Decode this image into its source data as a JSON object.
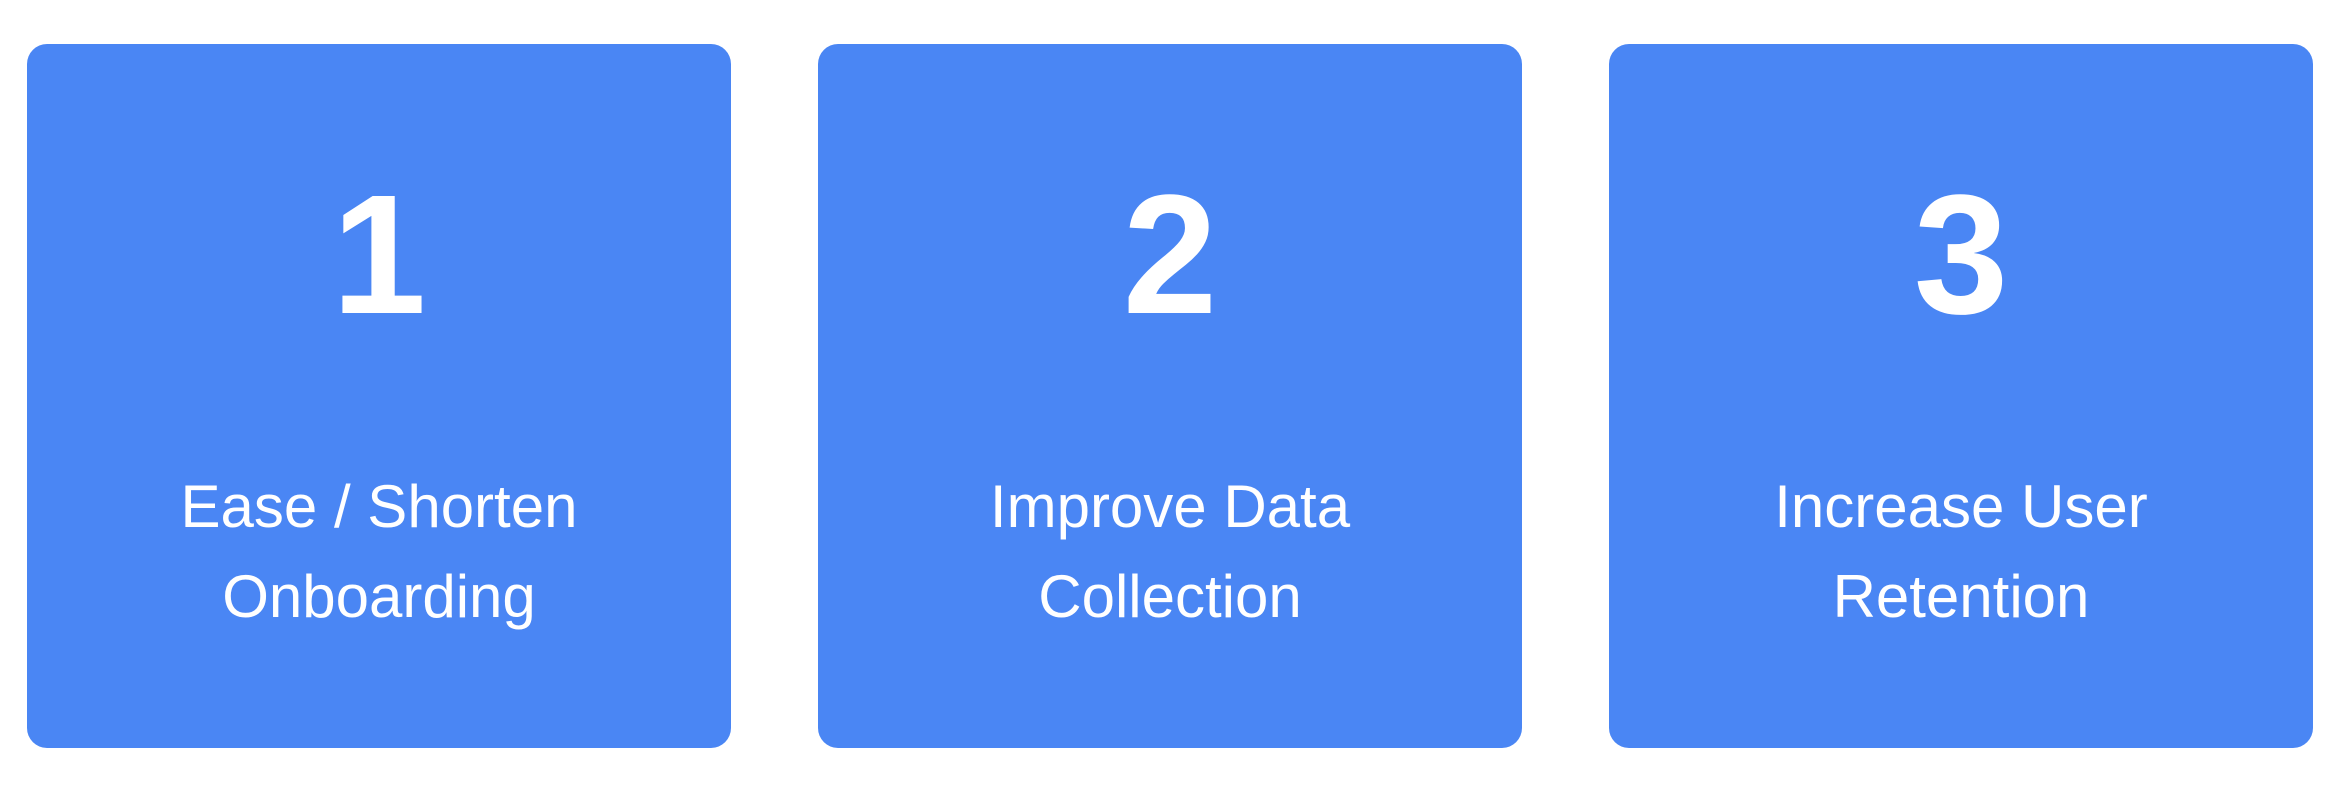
{
  "colors": {
    "card_background": "#4a86f4",
    "card_text": "#ffffff",
    "page_background": "#ffffff"
  },
  "cards": [
    {
      "number": "1",
      "title_line1": "Ease / Shorten",
      "title_line2": "Onboarding"
    },
    {
      "number": "2",
      "title_line1": "Improve Data",
      "title_line2": "Collection"
    },
    {
      "number": "3",
      "title_line1": "Increase User",
      "title_line2": "Retention"
    }
  ]
}
